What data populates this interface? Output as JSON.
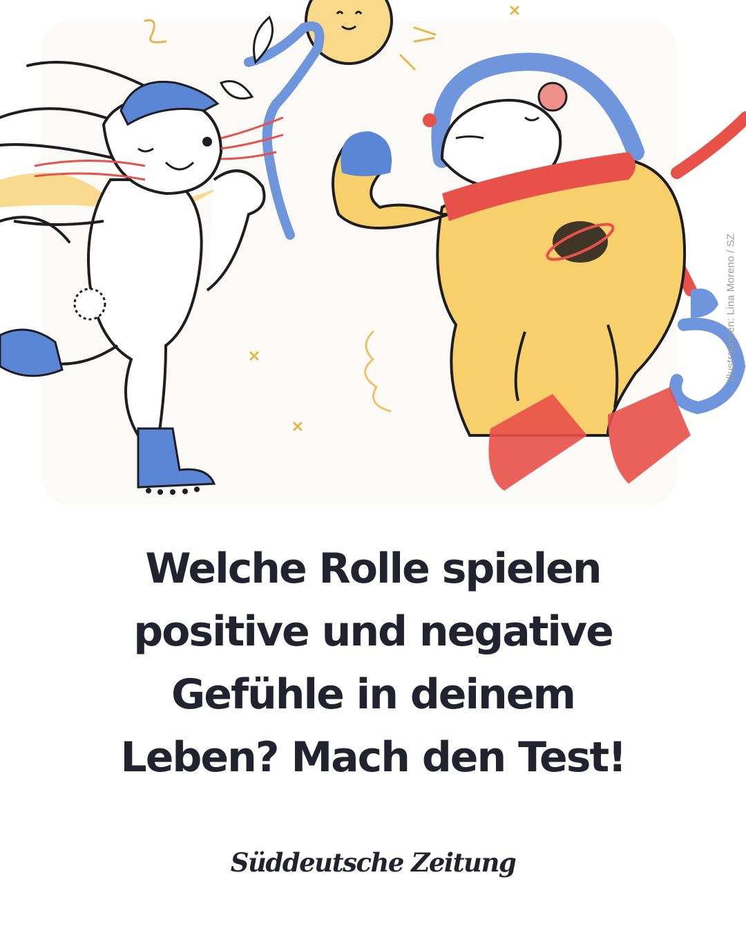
{
  "illustration": {
    "characters": [
      "rabbit-with-blue-cap-and-ribbon",
      "mouse-in-yellow-astronaut-suit"
    ],
    "colors": {
      "blue": "#5b86d6",
      "yellow": "#f7cf6b",
      "red": "#e8504a",
      "ink": "#1d1d22",
      "cream": "#fbfaf6"
    },
    "credit": "Illustrationen: Lina Moreno / SZ"
  },
  "headline": {
    "lines": [
      "Welche Rolle spielen",
      "positive und negative",
      "Gefühle in deinem",
      "Leben? Mach den Test!"
    ]
  },
  "brand": {
    "logo_text": "Süddeutsche Zeitung"
  }
}
